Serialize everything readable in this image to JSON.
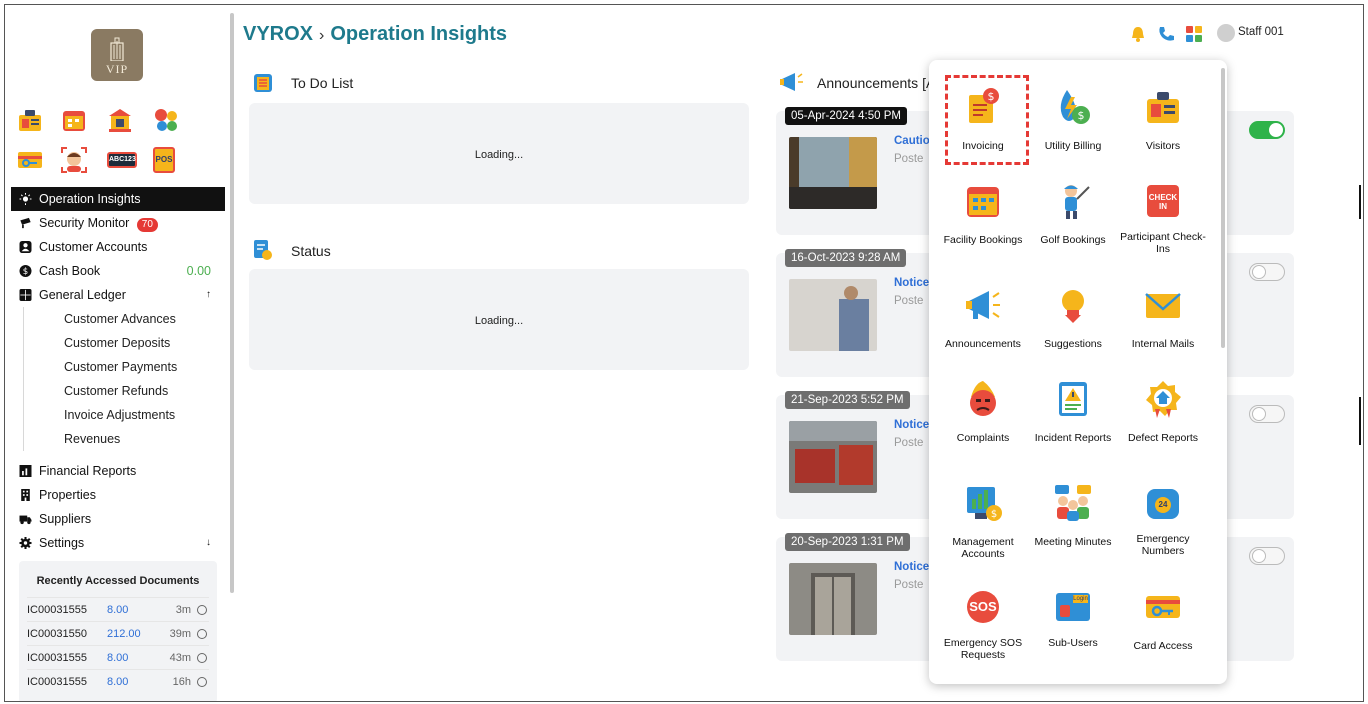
{
  "breadcrumb": {
    "app": "VYROX",
    "separator": "›",
    "page": "Operation Insights"
  },
  "header": {
    "user": "Staff 001",
    "icons": [
      "bell-icon",
      "phone-icon",
      "apps-grid-icon",
      "user-avatar-icon"
    ]
  },
  "logo": {
    "text": "VIP"
  },
  "quick_icons": [
    "visitors-icon",
    "calendar-icon",
    "building-icon",
    "molecule-icon",
    "card-key-icon",
    "face-scan-icon",
    "abc123-plate-icon",
    "pos-icon"
  ],
  "quick_icon_texts": {
    "plate": "ABC123",
    "pos": "POS"
  },
  "sidebar": {
    "items": [
      {
        "label": "Operation Insights",
        "icon": "bulb-icon"
      },
      {
        "label": "Security Monitor",
        "icon": "cctv-icon",
        "badge": "70"
      },
      {
        "label": "Customer Accounts",
        "icon": "person-icon"
      },
      {
        "label": "Cash Book",
        "icon": "dollar-icon",
        "amount": "0.00"
      },
      {
        "label": "General Ledger",
        "icon": "ledger-icon",
        "arrow": "↑"
      }
    ],
    "gl_sub": [
      "Customer Advances",
      "Customer Deposits",
      "Customer Payments",
      "Customer Refunds",
      "Invoice Adjustments",
      "Revenues"
    ],
    "more": [
      {
        "label": "Financial Reports",
        "icon": "report-icon"
      },
      {
        "label": "Properties",
        "icon": "building-icon"
      },
      {
        "label": "Suppliers",
        "icon": "truck-icon"
      },
      {
        "label": "Settings",
        "icon": "gear-icon",
        "arrow": "↓"
      }
    ]
  },
  "recent": {
    "title": "Recently Accessed Documents",
    "rows": [
      {
        "id": "IC00031555",
        "amount": "8.00",
        "time": "3m"
      },
      {
        "id": "IC00031550",
        "amount": "212.00",
        "time": "39m"
      },
      {
        "id": "IC00031555",
        "amount": "8.00",
        "time": "43m"
      },
      {
        "id": "IC00031555",
        "amount": "8.00",
        "time": "16h"
      }
    ]
  },
  "todo": {
    "title": "To Do List",
    "loading": "Loading..."
  },
  "status": {
    "title": "Status",
    "loading": "Loading..."
  },
  "announcements": {
    "title": "Announcements [A",
    "items": [
      {
        "date": "05-Apr-2024 4:50 PM",
        "title": "Cautio",
        "sub": "Poste",
        "toggle": true
      },
      {
        "date": "16-Oct-2023 9:28 AM",
        "title": "Notice",
        "sub": "Poste",
        "toggle": false
      },
      {
        "date": "21-Sep-2023 5:52 PM",
        "title": "Notice",
        "sub": "Poste",
        "toggle": false
      },
      {
        "date": "20-Sep-2023 1:31 PM",
        "title": "Notice",
        "sub": "Poste",
        "toggle": false
      }
    ]
  },
  "apps": [
    {
      "label": "Invoicing",
      "icon": "invoice-icon"
    },
    {
      "label": "Utility Billing",
      "icon": "utility-billing-icon"
    },
    {
      "label": "Visitors",
      "icon": "visitors-icon"
    },
    {
      "label": "Facility Bookings",
      "icon": "calendar-icon"
    },
    {
      "label": "Golf Bookings",
      "icon": "golfer-icon"
    },
    {
      "label": "Participant Check-Ins",
      "icon": "checkin-icon"
    },
    {
      "label": "Announcements",
      "icon": "megaphone-icon"
    },
    {
      "label": "Suggestions",
      "icon": "lightbulb-icon"
    },
    {
      "label": "Internal Mails",
      "icon": "envelope-icon"
    },
    {
      "label": "Complaints",
      "icon": "angry-face-icon"
    },
    {
      "label": "Incident Reports",
      "icon": "incident-report-icon"
    },
    {
      "label": "Defect Reports",
      "icon": "defect-badge-icon"
    },
    {
      "label": "Management Accounts",
      "icon": "management-accounts-icon"
    },
    {
      "label": "Meeting Minutes",
      "icon": "meeting-icon"
    },
    {
      "label": "Emergency Numbers",
      "icon": "emergency-phone-icon"
    },
    {
      "label": "Emergency SOS Requests",
      "icon": "sos-icon"
    },
    {
      "label": "Sub-Users",
      "icon": "sub-users-icon"
    },
    {
      "label": "Card Access",
      "icon": "card-access-icon"
    }
  ],
  "app_icon_texts": {
    "sos": "SOS",
    "checkin": "CHECK IN",
    "login": "Login",
    "emergency": "24"
  }
}
